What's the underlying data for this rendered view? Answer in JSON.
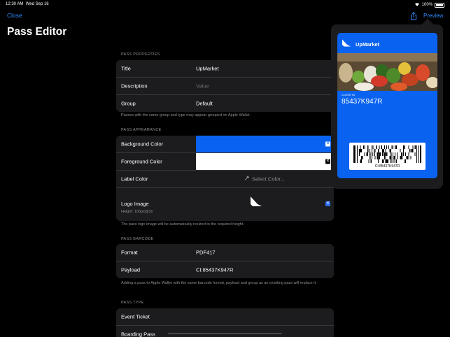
{
  "status": {
    "time": "12:30 AM",
    "date": "Wed Sep 16",
    "battery": "100%"
  },
  "nav": {
    "close": "Close",
    "title": "Pass Editor",
    "preview": "Preview"
  },
  "properties": {
    "header": "PASS PROPERTIES",
    "rows": [
      {
        "label": "Title",
        "value": "UpMarket"
      },
      {
        "label": "Description",
        "placeholder": "Value"
      },
      {
        "label": "Group",
        "value": "Default"
      }
    ],
    "note": "Passes with the same group and type may appear grouped on Apple Wallet."
  },
  "appearance": {
    "header": "PASS APPEARANCE",
    "background_label": "Background Color",
    "background_color": "#0a63f0",
    "foreground_label": "Foreground Color",
    "foreground_color": "#ffffff",
    "label_label": "Label Color",
    "select_color": "Select Color...",
    "logo_label": "Logo Image",
    "logo_sub": "Height: 105px@3x",
    "note": "The pass logo image will be automatically resized to the required height."
  },
  "barcode": {
    "header": "PASS BARCODE",
    "format_label": "Format",
    "format_value": "PDF417",
    "payload_label": "Payload",
    "payload_value": "CI:85437K947R",
    "note": "Adding a pass to Apple Wallet with the same barcode format, payload and group as an exisiting pass will replace it."
  },
  "type": {
    "header": "PASS TYPE",
    "rows": [
      "Event Ticket",
      "Boarding Pass"
    ]
  },
  "preview_pass": {
    "name": "UpMarket",
    "field_label": "CLIENT ID",
    "field_value": "85437K947R",
    "barcode_text": "CI:85437K947R"
  }
}
